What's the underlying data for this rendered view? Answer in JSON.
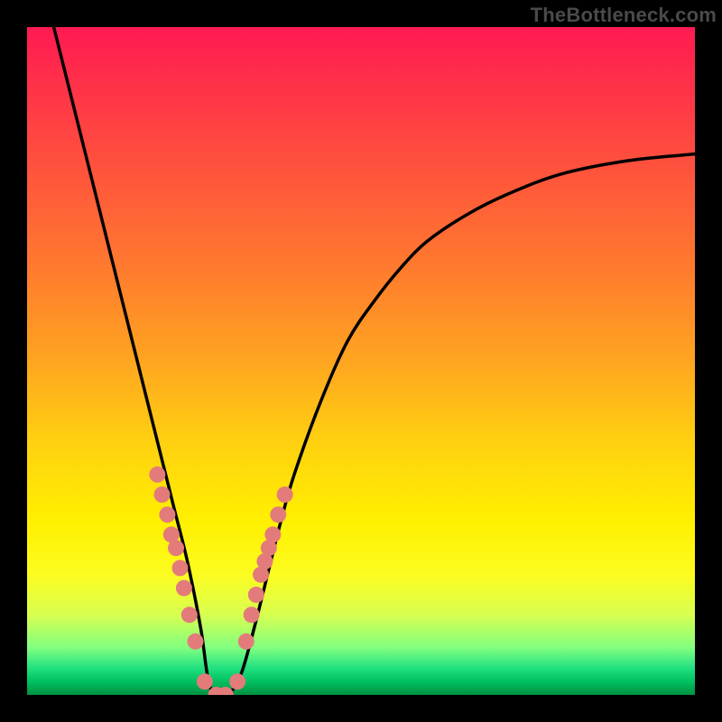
{
  "attribution": "TheBottleneck.com",
  "chart_data": {
    "type": "line",
    "title": "",
    "xlabel": "",
    "ylabel": "",
    "xlim": [
      0,
      100
    ],
    "ylim": [
      0,
      100
    ],
    "x": [
      4,
      6,
      8,
      10,
      12,
      14,
      16,
      18,
      20,
      22,
      24,
      26,
      27,
      28,
      30,
      32,
      34,
      36,
      38,
      40,
      44,
      48,
      52,
      56,
      60,
      66,
      72,
      80,
      90,
      100
    ],
    "values": [
      100,
      92,
      84,
      76,
      68,
      60,
      52,
      44,
      36,
      28,
      20,
      10,
      3,
      0,
      0,
      3,
      10,
      18,
      26,
      33,
      44,
      53,
      59,
      64,
      68,
      72,
      75,
      78,
      80,
      81
    ],
    "markers": {
      "x": [
        19.5,
        20.2,
        21.0,
        21.6,
        22.3,
        22.9,
        23.5,
        24.3,
        25.2,
        26.6,
        28.3,
        29.7,
        31.5,
        32.8,
        33.6,
        34.3,
        35.0,
        35.6,
        36.2,
        36.8,
        37.6,
        38.6
      ],
      "values": [
        33,
        30,
        27,
        24,
        22,
        19,
        16,
        12,
        8,
        2,
        0,
        0,
        2,
        8,
        12,
        15,
        18,
        20,
        22,
        24,
        27,
        30
      ],
      "color": "#e37b7b",
      "radius": 9
    },
    "curve_color": "#000000",
    "curve_width": 3.5,
    "gradient_stops": [
      {
        "pos": 0.0,
        "color": "#ff1a52"
      },
      {
        "pos": 0.5,
        "color": "#ffa520"
      },
      {
        "pos": 0.78,
        "color": "#fff000"
      },
      {
        "pos": 0.93,
        "color": "#80ff80"
      },
      {
        "pos": 1.0,
        "color": "#009040"
      }
    ]
  }
}
